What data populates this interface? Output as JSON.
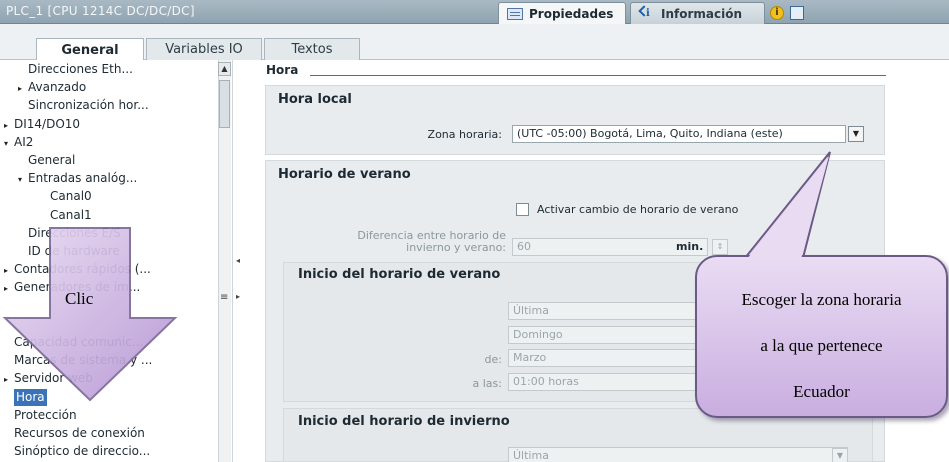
{
  "window": {
    "title": "PLC_1 [CPU 1214C DC/DC/DC]",
    "tabs": [
      {
        "label": "Propiedades",
        "active": true
      },
      {
        "label": "Información",
        "active": false
      }
    ]
  },
  "section_tabs": [
    "General",
    "Variables IO",
    "Textos"
  ],
  "nav_items": [
    {
      "label": "Direcciones Eth...",
      "indent": 1,
      "arrow": ""
    },
    {
      "label": "Avanzado",
      "indent": 1,
      "arrow": "▸"
    },
    {
      "label": "Sincronización hor...",
      "indent": 1,
      "arrow": ""
    },
    {
      "label": "DI14/DO10",
      "indent": 0,
      "arrow": "▸"
    },
    {
      "label": "AI2",
      "indent": 0,
      "arrow": "▾"
    },
    {
      "label": "General",
      "indent": 1,
      "arrow": ""
    },
    {
      "label": "Entradas analóg...",
      "indent": 1,
      "arrow": "▾"
    },
    {
      "label": "Canal0",
      "indent": 2,
      "arrow": ""
    },
    {
      "label": "Canal1",
      "indent": 2,
      "arrow": ""
    },
    {
      "label": "Direcciones E/S",
      "indent": 1,
      "arrow": ""
    },
    {
      "label": "ID de hardware",
      "indent": 1,
      "arrow": ""
    },
    {
      "label": "Contadores rápidos (...",
      "indent": 0,
      "arrow": "▸"
    },
    {
      "label": "Generadores de im...",
      "indent": 0,
      "arrow": "▸"
    },
    {
      "label": "",
      "indent": 0,
      "arrow": ""
    },
    {
      "label": "",
      "indent": 0,
      "arrow": ""
    },
    {
      "label": "Capacidad comunic...",
      "indent": 0,
      "arrow": ""
    },
    {
      "label": "Marcas de sistema y ...",
      "indent": 0,
      "arrow": ""
    },
    {
      "label": "Servidor web",
      "indent": 0,
      "arrow": "▸"
    },
    {
      "label": "Hora",
      "indent": 0,
      "arrow": "",
      "selected": true
    },
    {
      "label": "Protección",
      "indent": 0,
      "arrow": ""
    },
    {
      "label": "Recursos de conexión",
      "indent": 0,
      "arrow": ""
    },
    {
      "label": "Sinóptico de direccio...",
      "indent": 0,
      "arrow": ""
    }
  ],
  "content": {
    "section_title": "Hora",
    "local_time": {
      "title": "Hora local",
      "zone_label": "Zona horaria:",
      "zone_value": "(UTC -05:00) Bogotá, Lima, Quito, Indiana (este)"
    },
    "dst": {
      "title": "Horario de verano",
      "checkbox_label": "Activar cambio de horario de verano",
      "diff_label_line1": "Diferencia entre horario de",
      "diff_label_line2": "invierno y verano:",
      "diff_value": "60",
      "diff_unit": "min."
    },
    "dst_start": {
      "title": "Inicio del horario de verano",
      "week": "Última",
      "day": "Domingo",
      "month_label": "de:",
      "month": "Marzo",
      "time_label": "a las:",
      "time": "01:00 horas"
    },
    "winter_start": {
      "title": "Inicio del horario de invierno",
      "week": "Última"
    }
  },
  "annotations": {
    "arrow_label": "Clic",
    "callout_lines": [
      "Escoger la zona horaria",
      "a la que pertenece",
      "Ecuador"
    ]
  },
  "colors": {
    "titlebar": "#8fa3b0",
    "selected_nav": "#3b74b6",
    "callout_fill": "#d8c3e8",
    "arrow_fill": "#c9aee0"
  }
}
